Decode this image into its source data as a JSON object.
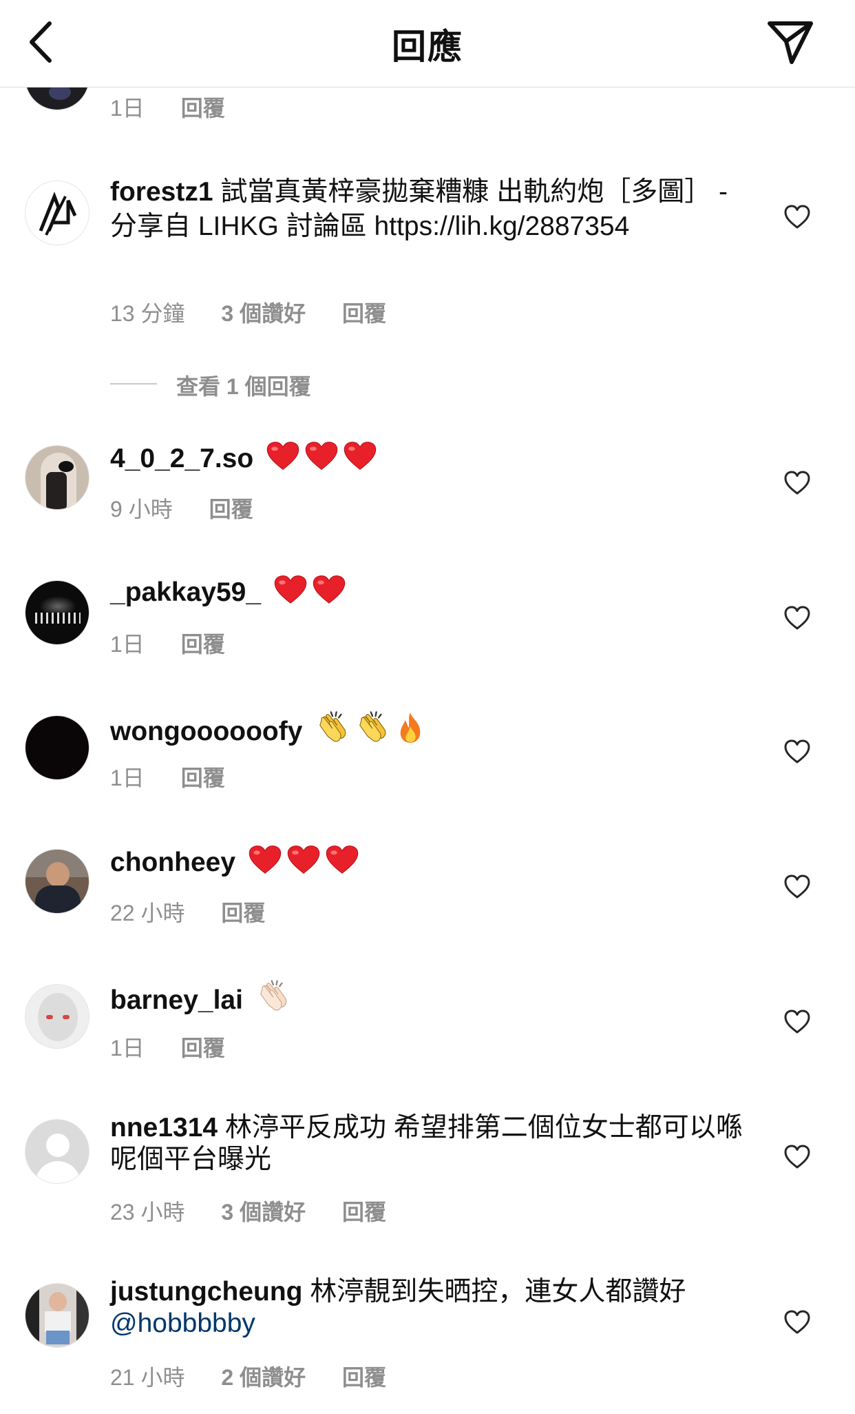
{
  "header": {
    "title": "回應",
    "back_icon": "chevron-left-icon",
    "send_icon": "paper-plane-icon"
  },
  "partial_comment": {
    "time": "1日",
    "reply": "回覆"
  },
  "view_replies": "查看 1 個回覆",
  "comments": [
    {
      "username": "forestz1",
      "text": "試當真黃梓豪拋棄糟糠 出軌約炮［多圖］ - 分享自 LIHKG 討論區 https://lih.kg/2887354",
      "time": "13 分鐘",
      "likes": "3 個讚好",
      "reply": "回覆"
    },
    {
      "username": "4_0_2_7.so",
      "emoji": "red-heart x3",
      "time": "9 小時",
      "reply": "回覆"
    },
    {
      "username": "_pakkay59_",
      "emoji": "red-heart x2",
      "time": "1日",
      "reply": "回覆"
    },
    {
      "username": "wongoooooofy",
      "emoji": "clapping-hands x2, fire",
      "time": "1日",
      "reply": "回覆"
    },
    {
      "username": "chonheey",
      "emoji": "red-heart x3",
      "time": "22 小時",
      "reply": "回覆"
    },
    {
      "username": "barney_lai",
      "emoji": "clapping-hands (light skin)",
      "time": "1日",
      "reply": "回覆"
    },
    {
      "username": "nne1314",
      "text": "林渟平反成功 希望排第二個位女士都可以喺呢個平台曝光",
      "time": "23 小時",
      "likes": "3 個讚好",
      "reply": "回覆"
    },
    {
      "username": "justungcheung",
      "text": "林渟靚到失晒控，連女人都讚好",
      "mention": "@hobbbbby",
      "time": "21 小時",
      "likes": "2 個讚好",
      "reply": "回覆"
    }
  ],
  "colors": {
    "heart_red": "#e8202a",
    "meta_gray": "#8e8e8e",
    "mention_blue": "#00376b",
    "clap_yellow": "#f6c338",
    "fire_orange": "#f47a1f"
  }
}
